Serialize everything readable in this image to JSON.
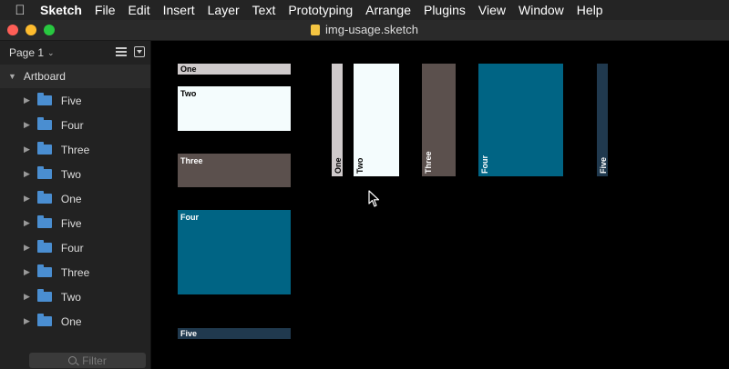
{
  "menubar": {
    "app": "Sketch",
    "items": [
      "File",
      "Edit",
      "Insert",
      "Layer",
      "Text",
      "Prototyping",
      "Arrange",
      "Plugins",
      "View",
      "Window",
      "Help"
    ]
  },
  "window": {
    "title": "img-usage.sketch"
  },
  "sidebar": {
    "page_label": "Page 1",
    "artboard_label": "Artboard",
    "layers": [
      "Five",
      "Four",
      "Three",
      "Two",
      "One",
      "Five",
      "Four",
      "Three",
      "Two",
      "One"
    ],
    "filter_placeholder": "Filter"
  },
  "canvas": {
    "left_stack": [
      {
        "label": "One",
        "color": "#cfcacb",
        "text_color": "#000"
      },
      {
        "label": "Two",
        "color": "#f4fcfd",
        "text_color": "#000"
      },
      {
        "label": "Three",
        "color": "#5b504d",
        "text_color": "#fff"
      },
      {
        "label": "Four",
        "color": "#006484",
        "text_color": "#fff"
      },
      {
        "label": "Five",
        "color": "#20394e",
        "text_color": "#fff"
      }
    ],
    "right_row": [
      {
        "label": "One",
        "color": "#cfcacb",
        "text_color": "#000"
      },
      {
        "label": "Two",
        "color": "#f4fcfd",
        "text_color": "#000"
      },
      {
        "label": "Three",
        "color": "#5b504d",
        "text_color": "#fff"
      },
      {
        "label": "Four",
        "color": "#006484",
        "text_color": "#fff"
      },
      {
        "label": "Five",
        "color": "#20394e",
        "text_color": "#fff"
      }
    ]
  }
}
